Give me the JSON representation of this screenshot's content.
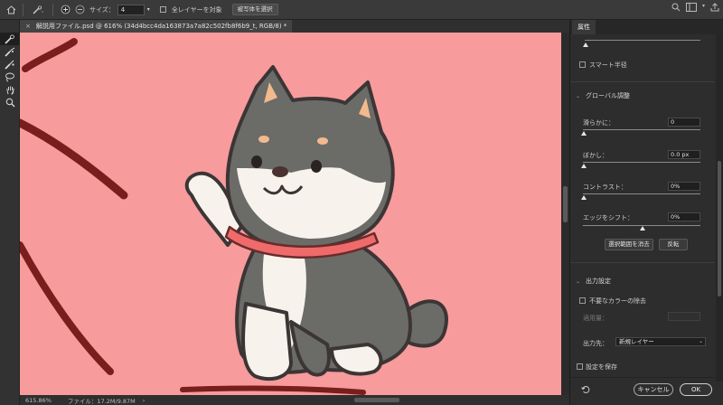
{
  "options_bar": {
    "size_label": "サイズ：",
    "size_value": "4",
    "sample_all_layers": "全レイヤーを対象",
    "select_subject": "被写体を選択"
  },
  "document": {
    "tab_title": "解説用ファイル.psd @ 616% (34d4bcc4da163873a7a82c502fb8f6b9_t, RGB/8) *",
    "zoom": "615.86%",
    "file_info": "ファイル：17.2M/9.87M"
  },
  "tools": [
    "quick-selection",
    "refine-edge-brush",
    "brush",
    "lasso",
    "hand",
    "zoom"
  ],
  "panel": {
    "tab": "属性",
    "smart_radius": "スマート半径",
    "global_title": "グローバル調整",
    "smooth_label": "滑らかに：",
    "smooth_value": "0",
    "feather_label": "ぼかし：",
    "feather_value": "0.0 px",
    "contrast_label": "コントラスト：",
    "contrast_value": "0%",
    "shift_label": "エッジをシフト：",
    "shift_value": "0%",
    "clear_selection": "選択範囲を消去",
    "invert": "反転",
    "output_title": "出力設定",
    "decontaminate": "不要なカラーの除去",
    "amount_label": "適用量：",
    "output_to_label": "出力先：",
    "output_to_value": "新規レイヤー",
    "remember": "設定を保存",
    "cancel": "キャンセル",
    "ok": "OK"
  },
  "colors": {
    "canvas_bg": "#f79b9c",
    "dog_gray": "#6b6b67",
    "collar": "#ef6b6b",
    "stroke": "#7a1d1d"
  }
}
